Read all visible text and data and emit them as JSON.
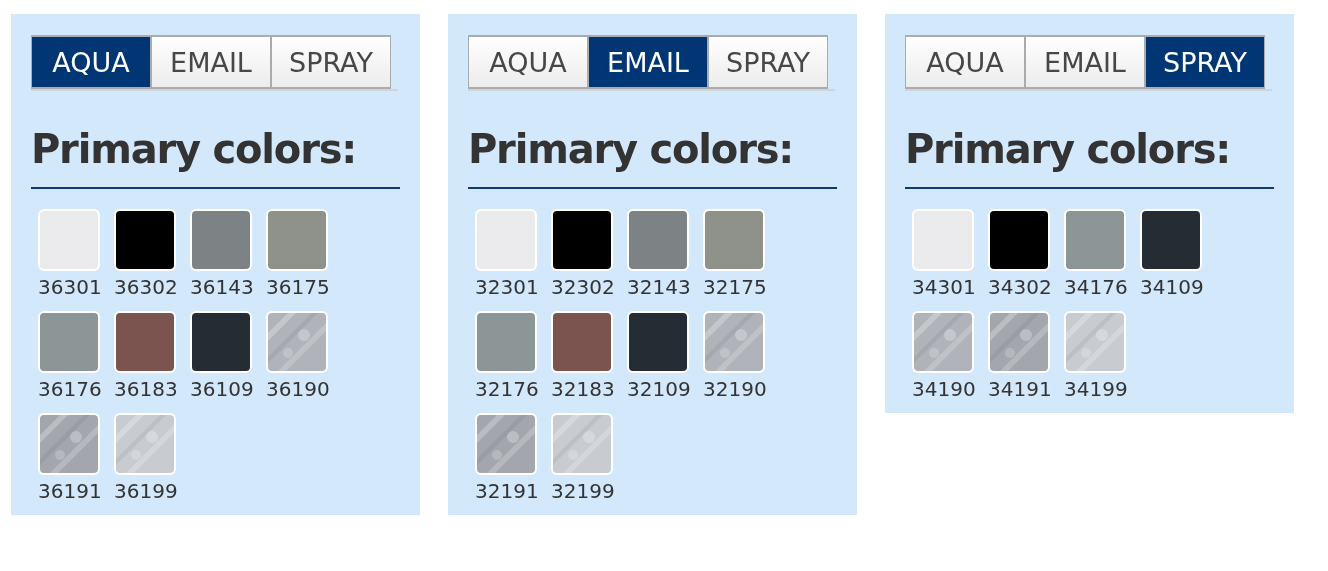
{
  "panels": [
    {
      "tabs": [
        {
          "label": "AQUA",
          "selected": true
        },
        {
          "label": "EMAIL",
          "selected": false
        },
        {
          "label": "SPRAY",
          "selected": false
        }
      ],
      "heading": "Primary colors:",
      "swatches": [
        {
          "code": "36301",
          "color": "#ebebed",
          "kind": "solid"
        },
        {
          "code": "36302",
          "color": "#000000",
          "kind": "solid"
        },
        {
          "code": "36143",
          "color": "#7d8385",
          "kind": "solid"
        },
        {
          "code": "36175",
          "color": "#8f918b",
          "kind": "solid"
        },
        {
          "code": "36176",
          "color": "#8c9697",
          "kind": "solid"
        },
        {
          "code": "36183",
          "color": "#7b5450",
          "kind": "solid"
        },
        {
          "code": "36109",
          "color": "#262c33",
          "kind": "solid"
        },
        {
          "code": "36190",
          "color": "#b0b4ba",
          "kind": "metallic"
        },
        {
          "code": "36191",
          "color": "#a3a7ad",
          "kind": "metallic"
        },
        {
          "code": "36199",
          "color": "#c8ccd1",
          "kind": "metallic"
        }
      ]
    },
    {
      "tabs": [
        {
          "label": "AQUA",
          "selected": false
        },
        {
          "label": "EMAIL",
          "selected": true
        },
        {
          "label": "SPRAY",
          "selected": false
        }
      ],
      "heading": "Primary colors:",
      "swatches": [
        {
          "code": "32301",
          "color": "#ebebed",
          "kind": "solid"
        },
        {
          "code": "32302",
          "color": "#000000",
          "kind": "solid"
        },
        {
          "code": "32143",
          "color": "#7d8385",
          "kind": "solid"
        },
        {
          "code": "32175",
          "color": "#8f918b",
          "kind": "solid"
        },
        {
          "code": "32176",
          "color": "#8c9697",
          "kind": "solid"
        },
        {
          "code": "32183",
          "color": "#7b5450",
          "kind": "solid"
        },
        {
          "code": "32109",
          "color": "#262c33",
          "kind": "solid"
        },
        {
          "code": "32190",
          "color": "#b0b4ba",
          "kind": "metallic"
        },
        {
          "code": "32191",
          "color": "#a3a7ad",
          "kind": "metallic"
        },
        {
          "code": "32199",
          "color": "#c8ccd1",
          "kind": "metallic"
        }
      ]
    },
    {
      "tabs": [
        {
          "label": "AQUA",
          "selected": false
        },
        {
          "label": "EMAIL",
          "selected": false
        },
        {
          "label": "SPRAY",
          "selected": true
        }
      ],
      "heading": "Primary colors:",
      "swatches": [
        {
          "code": "34301",
          "color": "#ebebed",
          "kind": "solid"
        },
        {
          "code": "34302",
          "color": "#000000",
          "kind": "solid"
        },
        {
          "code": "34176",
          "color": "#8c9697",
          "kind": "solid"
        },
        {
          "code": "34109",
          "color": "#262c33",
          "kind": "solid"
        },
        {
          "code": "34190",
          "color": "#b0b4ba",
          "kind": "metallic"
        },
        {
          "code": "34191",
          "color": "#a3a7ad",
          "kind": "metallic"
        },
        {
          "code": "34199",
          "color": "#c8ccd1",
          "kind": "metallic"
        }
      ]
    }
  ]
}
